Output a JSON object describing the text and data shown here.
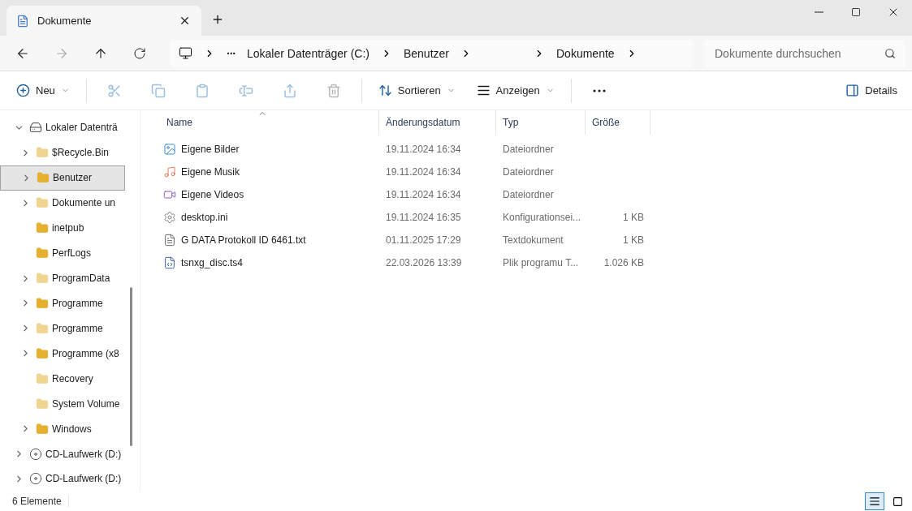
{
  "tab": {
    "title": "Dokumente",
    "selected": true
  },
  "breadcrumb": [
    {
      "kind": "computer"
    },
    {
      "kind": "more",
      "label": "···"
    },
    {
      "kind": "text",
      "label": "Lokaler Datenträger (C:)"
    },
    {
      "kind": "text",
      "label": "Benutzer"
    },
    {
      "kind": "blank"
    },
    {
      "kind": "text",
      "label": "Dokumente"
    }
  ],
  "search": {
    "placeholder": "Dokumente durchsuchen"
  },
  "toolbar": [
    {
      "kind": "new",
      "label": "Neu",
      "disabled": false
    },
    {
      "kind": "cut",
      "disabled": true
    },
    {
      "kind": "copy",
      "disabled": true
    },
    {
      "kind": "paste",
      "disabled": true
    },
    {
      "kind": "rename",
      "disabled": true
    },
    {
      "kind": "share",
      "disabled": true
    },
    {
      "kind": "delete",
      "disabled": true
    },
    {
      "kind": "sort",
      "label": "Sortieren",
      "disabled": false
    },
    {
      "kind": "view",
      "label": "Anzeigen",
      "disabled": false
    },
    {
      "kind": "more",
      "disabled": false
    }
  ],
  "details_button": {
    "label": "Details"
  },
  "sidebar": {
    "items": [
      {
        "label": "Lokaler Datenträ",
        "kind": "drive",
        "expanded": true,
        "selected": false,
        "children": [
          {
            "label": "$Recycle.Bin",
            "kind": "folder-hidden",
            "expanded": false,
            "selected": false
          },
          {
            "label": "Benutzer",
            "kind": "folder",
            "expanded": false,
            "selected": true
          },
          {
            "label": "Dokumente un",
            "kind": "link",
            "expanded": false,
            "selected": false
          },
          {
            "label": "inetpub",
            "kind": "folder",
            "selected": false
          },
          {
            "label": "PerfLogs",
            "kind": "folder",
            "selected": false
          },
          {
            "label": "ProgramData",
            "kind": "folder-hidden",
            "expanded": false,
            "selected": false
          },
          {
            "label": "Programme",
            "kind": "folder",
            "expanded": false,
            "selected": false
          },
          {
            "label": "Programme",
            "kind": "link",
            "expanded": false,
            "selected": false
          },
          {
            "label": "Programme (x8",
            "kind": "folder",
            "expanded": false,
            "selected": false
          },
          {
            "label": "Recovery",
            "kind": "folder-hidden",
            "selected": false
          },
          {
            "label": "System Volume",
            "kind": "folder-hidden",
            "selected": false
          },
          {
            "label": "Windows",
            "kind": "folder",
            "expanded": false,
            "selected": false
          }
        ]
      },
      {
        "label": "CD-Laufwerk (D:)",
        "kind": "cd",
        "expanded": false,
        "selected": false
      },
      {
        "label": "CD-Laufwerk (D:)",
        "kind": "cd",
        "expanded": false,
        "selected": false
      }
    ]
  },
  "table": {
    "columns": [
      "Name",
      "Änderungsdatum",
      "Typ",
      "Größe"
    ],
    "rows": [
      {
        "kind": "pictures",
        "name": "Eigene Bilder",
        "date": "19.11.2024 16:34",
        "type": "Dateiordner"
      },
      {
        "kind": "music",
        "name": "Eigene Musik",
        "date": "19.11.2024 16:34",
        "type": "Dateiordner"
      },
      {
        "kind": "videos",
        "name": "Eigene Videos",
        "date": "19.11.2024 16:34",
        "type": "Dateiordner"
      },
      {
        "kind": "config",
        "name": "desktop.ini",
        "date": "19.11.2024 16:35",
        "type": "Konfigurationsei...",
        "size": "1 KB"
      },
      {
        "kind": "text",
        "name": "G DATA Protokoll ID 6461.txt",
        "date": "01.11.2025 17:29",
        "type": "Textdokument",
        "size": "1 KB"
      },
      {
        "kind": "program",
        "name": "tsnxg_disc.ts4",
        "date": "22.03.2026 13:39",
        "type": "Plik programu T...",
        "size": "1.026 KB"
      }
    ]
  },
  "status_bar": {
    "count": "6 Elemente",
    "views": [
      {
        "kind": "details",
        "selected": true
      },
      {
        "kind": "tiles",
        "selected": false
      }
    ]
  }
}
